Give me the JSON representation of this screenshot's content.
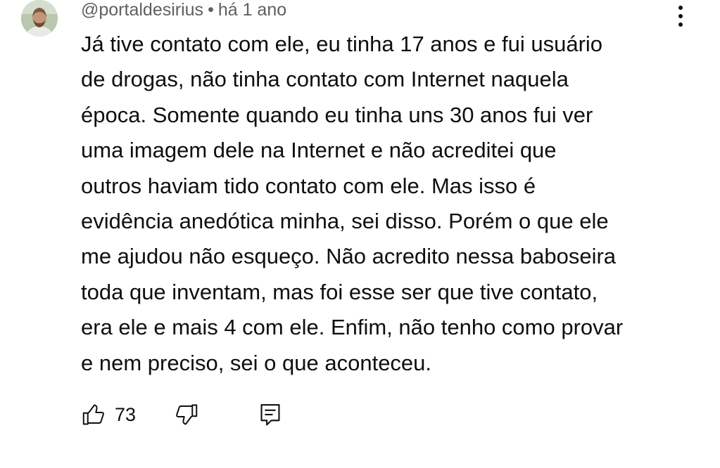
{
  "comment": {
    "author": "@portaldesirius",
    "separator": "•",
    "time": "há 1 ano",
    "text_lines": [
      "Já tive contato com ele, eu tinha 17 anos e fui usuário",
      "de drogas, não tinha contato com Internet naquela",
      "época. Somente quando eu tinha uns 30 anos fui ver",
      "uma imagem dele na Internet e não acreditei que",
      "outros haviam tido contato com ele. Mas isso é",
      "evidência anedótica minha, sei disso. Porém o que ele",
      "me ajudou não esqueço. Não acredito nessa baboseira",
      "toda que inventam, mas foi esse ser que tive contato,",
      "era ele e mais 4 com ele. Enfim, não tenho como provar",
      "e nem preciso, sei o que aconteceu."
    ],
    "likes": "73"
  },
  "icons": {
    "avatar": "avatar",
    "more": "more-vert-icon",
    "like": "thumb-up-icon",
    "dislike": "thumb-down-icon",
    "reply": "reply-comment-icon"
  },
  "colors": {
    "text": "#0f0f0f",
    "meta": "#606060",
    "background": "#ffffff"
  }
}
